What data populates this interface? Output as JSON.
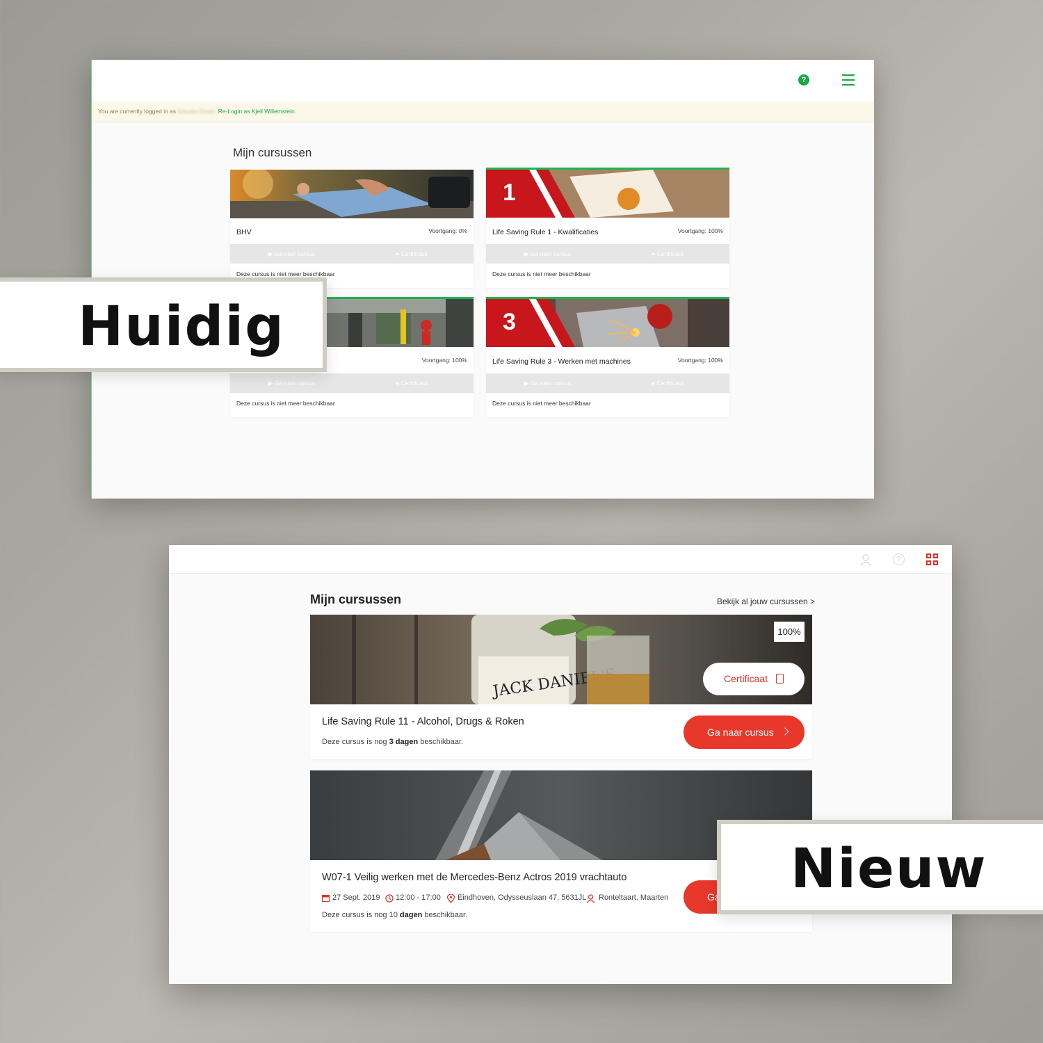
{
  "old": {
    "banner_prefix": "You are currently logged in as",
    "banner_blurred": "Klaudia Zwets.",
    "banner_relogin": "Re-Login as Kjell Willemstein.",
    "page_title": "Mijn cursussen",
    "go_label": "Ga naar cursus",
    "cert_label": "Certificaat",
    "courses": [
      {
        "name": "BHV",
        "progress": "Voortgang: 0%",
        "note": "Deze cursus is niet meer beschikbaar"
      },
      {
        "name": "Life Saving Rule 1 - Kwalificaties",
        "progress": "Voortgang: 100%",
        "number": "1",
        "note": "Deze cursus is niet meer beschikbaar"
      },
      {
        "name": "",
        "progress": "Voortgang: 100%",
        "note": "Deze cursus is niet meer beschikbaar"
      },
      {
        "name": "Life Saving Rule 3 - Werken met machines",
        "progress": "Voortgang: 100%",
        "number": "3",
        "note": "Deze cursus is niet meer beschikbaar"
      }
    ],
    "colors": {
      "accent": "#18a94a",
      "red": "#c8161d"
    }
  },
  "new": {
    "page_title": "Mijn cursussen",
    "view_all": "Bekijk al jouw cursussen >",
    "icons": [
      "user-icon",
      "help-icon",
      "grid-icon"
    ],
    "courses": [
      {
        "percent": "100%",
        "cert_label": "Certificaat",
        "name": "Life Saving Rule 11 - Alcohol, Drugs & Roken",
        "note_pre": "Deze cursus is nog ",
        "note_bold": "3 dagen",
        "note_post": " beschikbaar.",
        "go_label": "Ga naar cursus"
      },
      {
        "name": "W07-1 Veilig werken met de Mercedes-Benz Actros 2019 vrachtauto",
        "date": "27 Sept. 2019",
        "time": "12:00 - 17:00",
        "location": "Eindhoven, Odysseuslaan 47, 5631JL",
        "instructor": "Ronteltaart, Maarten",
        "note_pre": "Deze cursus is nog 10 ",
        "note_bold": "dagen",
        "note_post": " beschikbaar.",
        "go_label": "Ga"
      }
    ],
    "colors": {
      "accent": "#e7382b"
    }
  },
  "labels": {
    "current": "Huidig",
    "new": "Nieuw"
  }
}
